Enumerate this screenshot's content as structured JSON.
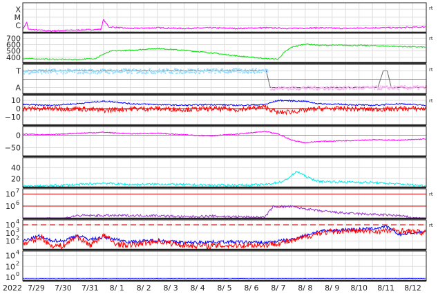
{
  "chart_data": {
    "type": "line",
    "title": "",
    "year_label": "2022",
    "x_tick_labels": [
      "7/29",
      "7/30",
      "7/31",
      "8/ 1",
      "8/ 2",
      "8/ 3",
      "8/ 4",
      "8/ 5",
      "8/ 6",
      "8/ 7",
      "8/ 8",
      "8/ 9",
      "8/10",
      "8/11",
      "8/12"
    ],
    "x_unit": "days since 2022-07-29 00:00",
    "xlim": [
      0,
      15
    ],
    "rt_label": "rt",
    "panels": [
      {
        "name": "xray",
        "scale": "log10",
        "ylim": [
          -6.9,
          -3.2
        ],
        "tick_labels": [
          {
            "v": -4,
            "t": "X"
          },
          {
            "v": -5,
            "t": "M"
          },
          {
            "v": -6,
            "t": "C"
          }
        ],
        "rt": true,
        "series": [
          {
            "name": "X-ray flux",
            "color": "#ff00ff",
            "noise": 0.08,
            "points": [
              [
                0,
                -6.5
              ],
              [
                0.15,
                -5.6
              ],
              [
                0.2,
                -6.5
              ],
              [
                1,
                -6.7
              ],
              [
                2,
                -6.6
              ],
              [
                2.9,
                -6.5
              ],
              [
                3,
                -5.3
              ],
              [
                3.2,
                -6.2
              ],
              [
                4,
                -6.4
              ],
              [
                5,
                -6.3
              ],
              [
                6,
                -6.4
              ],
              [
                7,
                -6.3
              ],
              [
                8,
                -6.4
              ],
              [
                9,
                -6.3
              ],
              [
                10,
                -6.4
              ],
              [
                11,
                -6.3
              ],
              [
                12,
                -6.4
              ],
              [
                13,
                -6.3
              ],
              [
                14,
                -6.3
              ],
              [
                15,
                -6.2
              ]
            ]
          }
        ]
      },
      {
        "name": "solar-wind-speed",
        "scale": "linear",
        "ylim": [
          310,
          780
        ],
        "tick_labels": [
          {
            "v": 700,
            "t": "700"
          },
          {
            "v": 600,
            "t": "600"
          },
          {
            "v": 500,
            "t": "500"
          },
          {
            "v": 400,
            "t": "400"
          }
        ],
        "rt": true,
        "series": [
          {
            "name": "Speed (km/s)",
            "color": "#00e000",
            "noise": 8,
            "points": [
              [
                0,
                380
              ],
              [
                1,
                370
              ],
              [
                2,
                365
              ],
              [
                2.7,
                380
              ],
              [
                3,
                450
              ],
              [
                3.3,
                500
              ],
              [
                4,
                510
              ],
              [
                5,
                540
              ],
              [
                6,
                510
              ],
              [
                7,
                470
              ],
              [
                8,
                420
              ],
              [
                9,
                380
              ],
              [
                9.5,
                370
              ],
              [
                9.7,
                470
              ],
              [
                10,
                560
              ],
              [
                10.5,
                610
              ],
              [
                11,
                590
              ],
              [
                12,
                590
              ],
              [
                13,
                585
              ],
              [
                14,
                570
              ],
              [
                15,
                560
              ]
            ]
          }
        ]
      },
      {
        "name": "imf-sector",
        "scale": "category",
        "ylim": [
          0,
          1
        ],
        "tick_labels": [
          {
            "v": 0.78,
            "t": "T"
          },
          {
            "v": 0.22,
            "t": "A"
          }
        ],
        "rt": true,
        "series": [
          {
            "name": "sector line",
            "color": "#666666",
            "noise": 0,
            "points": [
              [
                0,
                0.78
              ],
              [
                9.05,
                0.78
              ],
              [
                9.2,
                0.22
              ],
              [
                13.2,
                0.22
              ],
              [
                13.4,
                0.78
              ],
              [
                13.55,
                0.78
              ],
              [
                13.7,
                0.22
              ],
              [
                15,
                0.22
              ]
            ]
          },
          {
            "name": "toward points",
            "color": "#99ddff",
            "noise": 0.08,
            "points": [
              [
                0,
                0.78
              ],
              [
                9.1,
                0.8
              ]
            ]
          },
          {
            "name": "away points",
            "color": "#f5b0f0",
            "noise": 0.06,
            "points": [
              [
                9.2,
                0.22
              ],
              [
                15,
                0.24
              ]
            ]
          }
        ]
      },
      {
        "name": "imf-bz-bt",
        "scale": "linear",
        "ylim": [
          -20,
          16
        ],
        "tick_labels": [
          {
            "v": 10,
            "t": "10"
          },
          {
            "v": 0,
            "t": "0"
          },
          {
            "v": -10,
            "t": "−10"
          }
        ],
        "rt": true,
        "series": [
          {
            "name": "Bt",
            "color": "#0000ff",
            "noise": 0.8,
            "points": [
              [
                0,
                5
              ],
              [
                1,
                4
              ],
              [
                2,
                6
              ],
              [
                3,
                9
              ],
              [
                3.5,
                8
              ],
              [
                4,
                6
              ],
              [
                5,
                5
              ],
              [
                6,
                4
              ],
              [
                7,
                5
              ],
              [
                8,
                4
              ],
              [
                9,
                5
              ],
              [
                9.5,
                10
              ],
              [
                10.5,
                9
              ],
              [
                11,
                6
              ],
              [
                12,
                5
              ],
              [
                13,
                4
              ],
              [
                14,
                6
              ],
              [
                15,
                4
              ]
            ]
          },
          {
            "name": "Bz",
            "color": "#ff0000",
            "noise": 3,
            "points": [
              [
                0,
                0
              ],
              [
                2,
                0
              ],
              [
                3,
                -2
              ],
              [
                4,
                0
              ],
              [
                5,
                0
              ],
              [
                6,
                -1
              ],
              [
                7,
                0
              ],
              [
                8,
                -1
              ],
              [
                9,
                2
              ],
              [
                9.5,
                -5
              ],
              [
                10.5,
                -2
              ],
              [
                11,
                0
              ],
              [
                12,
                0
              ],
              [
                13,
                -1
              ],
              [
                14,
                0
              ],
              [
                15,
                0
              ]
            ]
          }
        ]
      },
      {
        "name": "dst",
        "scale": "linear",
        "ylim": [
          -85,
          35
        ],
        "tick_labels": [
          {
            "v": 0,
            "t": "0"
          },
          {
            "v": -50,
            "t": "−50"
          }
        ],
        "rt": false,
        "series": [
          {
            "name": "Dst",
            "color": "#ff00ff",
            "noise": 2,
            "points": [
              [
                0,
                5
              ],
              [
                1,
                2
              ],
              [
                2,
                8
              ],
              [
                3,
                12
              ],
              [
                4,
                6
              ],
              [
                5,
                8
              ],
              [
                6,
                2
              ],
              [
                7,
                -2
              ],
              [
                8,
                5
              ],
              [
                9,
                15
              ],
              [
                9.5,
                5
              ],
              [
                10,
                -20
              ],
              [
                10.5,
                -30
              ],
              [
                11,
                -25
              ],
              [
                12,
                -22
              ],
              [
                13,
                -18
              ],
              [
                14,
                -20
              ],
              [
                15,
                -15
              ]
            ]
          }
        ]
      },
      {
        "name": "kp-ap",
        "scale": "linear",
        "ylim": [
          4,
          58
        ],
        "tick_labels": [
          {
            "v": 40,
            "t": "40"
          },
          {
            "v": 20,
            "t": "20"
          }
        ],
        "rt": false,
        "series": [
          {
            "name": "index",
            "color": "#00eeee",
            "noise": 2,
            "points": [
              [
                0,
                6
              ],
              [
                1,
                7
              ],
              [
                2,
                9
              ],
              [
                3,
                12
              ],
              [
                4,
                9
              ],
              [
                5,
                10
              ],
              [
                6,
                9
              ],
              [
                7,
                8
              ],
              [
                8,
                8
              ],
              [
                9,
                9
              ],
              [
                9.7,
                15
              ],
              [
                10.2,
                33
              ],
              [
                10.6,
                22
              ],
              [
                11,
                15
              ],
              [
                12,
                14
              ],
              [
                13,
                13
              ],
              [
                14,
                10
              ],
              [
                15,
                7
              ]
            ]
          }
        ]
      },
      {
        "name": "electron-flux",
        "scale": "log10",
        "ylim": [
          4.95,
          7.45
        ],
        "tick_labels": [
          {
            "v": 7,
            "t": "10",
            "sup": "7"
          },
          {
            "v": 6,
            "t": "10",
            "sup": "6"
          }
        ],
        "ref_lines": [
          7,
          6
        ],
        "rt": true,
        "series": [
          {
            "name": "electrons >2MeV",
            "color": "#9933cc",
            "noise": 0.1,
            "points": [
              [
                0,
                4.9
              ],
              [
                1.5,
                4.95
              ],
              [
                2,
                5.2
              ],
              [
                3,
                5.2
              ],
              [
                4,
                5.2
              ],
              [
                5,
                5.2
              ],
              [
                6,
                5.1
              ],
              [
                7,
                5.15
              ],
              [
                8,
                5.1
              ],
              [
                9,
                5.05
              ],
              [
                9.3,
                5.95
              ],
              [
                10,
                5.95
              ],
              [
                11,
                5.6
              ],
              [
                12,
                5.4
              ],
              [
                13,
                5.3
              ],
              [
                14,
                5.2
              ],
              [
                14.5,
                5.0
              ],
              [
                15,
                4.9
              ]
            ]
          }
        ]
      },
      {
        "name": "proton-flux",
        "scale": "log10",
        "ylim": [
          0.95,
          4.6
        ],
        "tick_labels": [
          {
            "v": 4,
            "t": "10",
            "sup": "4"
          },
          {
            "v": 3,
            "t": "10",
            "sup": "3"
          },
          {
            "v": 2,
            "t": "10",
            "sup": "2"
          }
        ],
        "ref_dashed": 4,
        "rt": true,
        "series": [
          {
            "name": "blue",
            "color": "#0000ff",
            "noise": 0.2,
            "points": [
              [
                0,
                2
              ],
              [
                0.6,
                2.6
              ],
              [
                1,
                2.1
              ],
              [
                1.5,
                2
              ],
              [
                2,
                2.7
              ],
              [
                2.5,
                2.2
              ],
              [
                3,
                2.5
              ],
              [
                4,
                1.9
              ],
              [
                5,
                2.1
              ],
              [
                6,
                1.8
              ],
              [
                7,
                1.9
              ],
              [
                8,
                1.9
              ],
              [
                9,
                1.8
              ],
              [
                10,
                2.2
              ],
              [
                11,
                3.2
              ],
              [
                12,
                3.4
              ],
              [
                13,
                3.5
              ],
              [
                13.5,
                3.8
              ],
              [
                14,
                2.8
              ],
              [
                15,
                3.2
              ]
            ]
          },
          {
            "name": "red",
            "color": "#ff0000",
            "noise": 0.35,
            "points": [
              [
                0,
                1.6
              ],
              [
                0.7,
                2.5
              ],
              [
                1,
                1.5
              ],
              [
                1.5,
                1.4
              ],
              [
                2,
                2.6
              ],
              [
                2.5,
                1.5
              ],
              [
                3,
                2.7
              ],
              [
                3.5,
                1.6
              ],
              [
                4,
                1.5
              ],
              [
                5,
                2
              ],
              [
                6,
                1.5
              ],
              [
                7,
                1.4
              ],
              [
                8,
                1.5
              ],
              [
                9,
                1.5
              ],
              [
                10,
                2
              ],
              [
                11,
                3
              ],
              [
                12,
                3.3
              ],
              [
                13,
                3.2
              ],
              [
                14,
                3.3
              ],
              [
                15,
                3
              ]
            ]
          }
        ]
      },
      {
        "name": "high-energy-flux",
        "scale": "log10",
        "ylim": [
          -0.6,
          4.8
        ],
        "tick_labels": [
          {
            "v": 4,
            "t": "10",
            "sup": "4"
          },
          {
            "v": 2,
            "t": "10",
            "sup": "2"
          },
          {
            "v": 0,
            "t": "10",
            "sup": "0"
          }
        ],
        "rt": false,
        "series": [
          {
            "name": "flux",
            "color": "#0000ff",
            "noise": 0.04,
            "points": [
              [
                0,
                -0.2
              ],
              [
                15,
                -0.18
              ]
            ]
          }
        ]
      }
    ]
  }
}
